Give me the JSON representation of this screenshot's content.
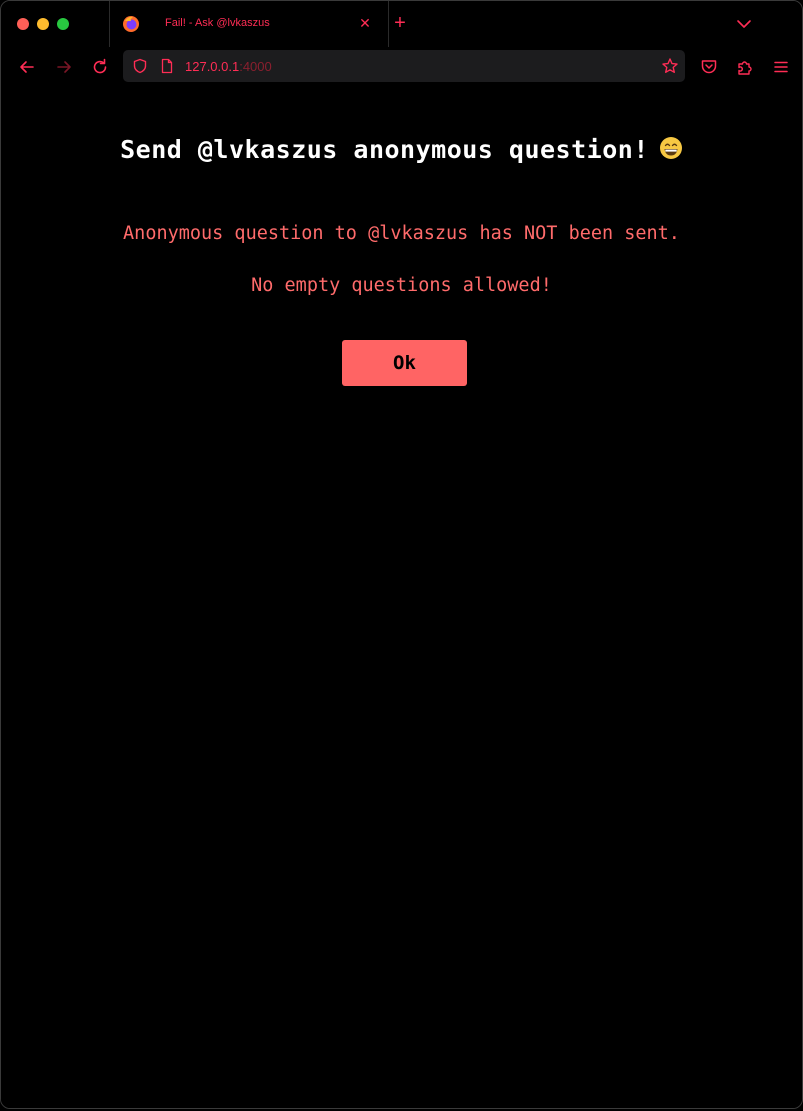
{
  "browser": {
    "tab": {
      "title": "Fail! - Ask @lvkaszus",
      "close_glyph": "✕"
    },
    "new_tab_glyph": "+",
    "url": {
      "host": "127.0.0.1",
      "port": ":4000"
    },
    "icons": {
      "favicon": "firefox-icon",
      "back": "arrow-left-icon",
      "forward": "arrow-right-icon",
      "reload": "reload-icon",
      "shield": "shield-icon",
      "page": "page-icon",
      "bookmark": "star-icon",
      "pocket": "pocket-icon",
      "extensions": "puzzle-icon",
      "menu": "hamburger-icon",
      "tab_list": "chevron-down-icon"
    },
    "accent_color": "#ff2d55"
  },
  "page": {
    "heading": "Send @lvkaszus anonymous question!",
    "heading_emoji": "grinning-face-icon",
    "message_1": "Anonymous question to @lvkaszus has NOT been sent.",
    "message_2": "No empty questions allowed!",
    "ok_button": "Ok",
    "error_color": "#ff6b6b",
    "button_color": "#ff6464"
  }
}
